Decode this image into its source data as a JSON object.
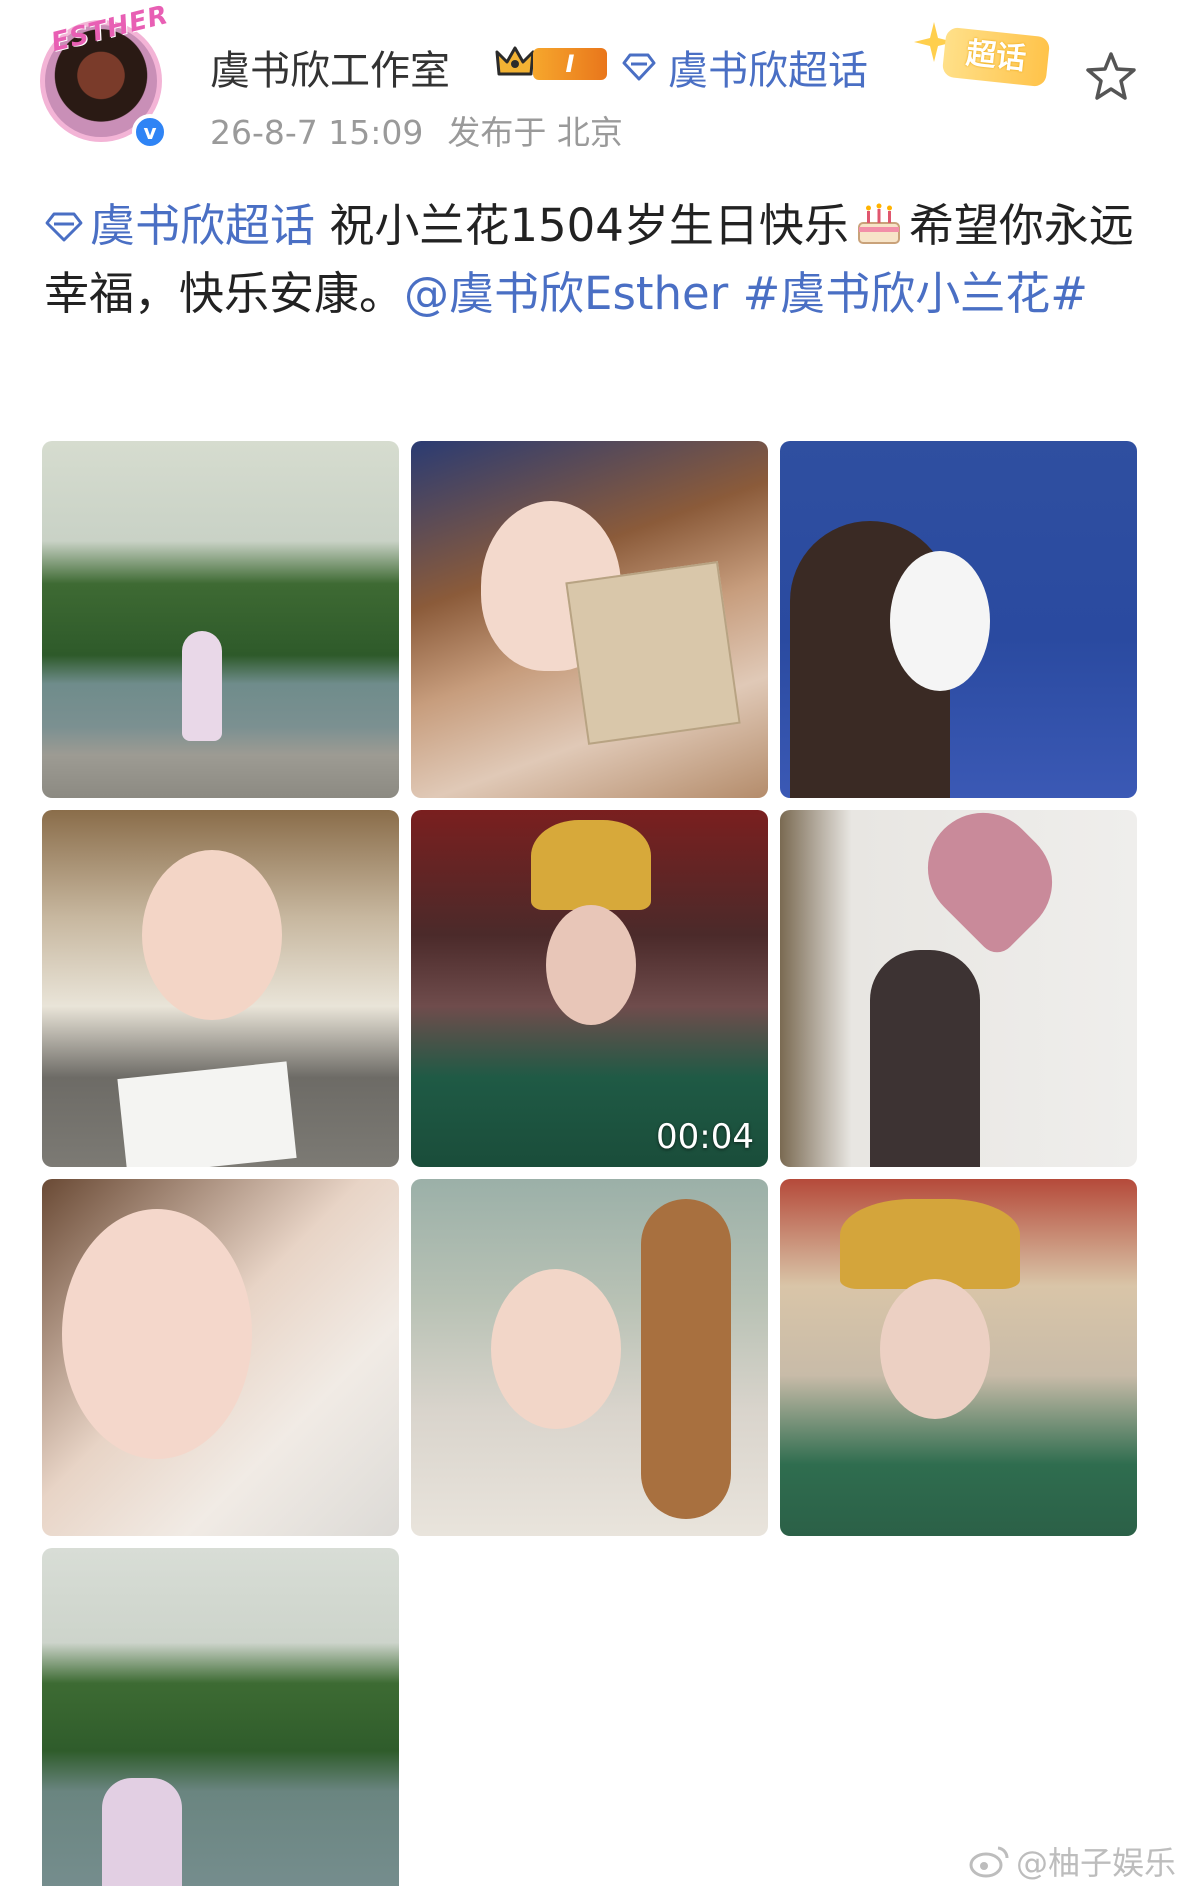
{
  "header": {
    "avatar_text": "ESTHER",
    "verified_mark": "v",
    "username": "虞书欣工作室",
    "level_label": "I",
    "super_topic_label": "虞书欣超话",
    "chaohua_badge_label": "超话",
    "timestamp": "26-8-7 15:09",
    "location": "发布于 北京"
  },
  "post": {
    "topic_link": "虞书欣超话",
    "text_part1": " 祝小兰花1504岁生日快乐",
    "text_part2": "希望你永远幸福，快乐安康。",
    "mention": "@虞书欣Esther",
    "hashtag": "#虞书欣小兰花#"
  },
  "photos": [
    {
      "label": "lake-hills-photo-1"
    },
    {
      "label": "set-selfie-with-paper-photo"
    },
    {
      "label": "white-mask-photo"
    },
    {
      "label": "lying-on-table-photo"
    },
    {
      "label": "bridal-headdress-video",
      "duration": "00:04"
    },
    {
      "label": "heart-balloon-photo"
    },
    {
      "label": "close-up-selfie-photo"
    },
    {
      "label": "feather-fan-photo"
    },
    {
      "label": "red-tassel-crown-photo"
    },
    {
      "label": "lake-hills-photo-2"
    }
  ],
  "watermark": "@柚子娱乐",
  "colors": {
    "link": "#4a6fc4",
    "verified": "#2f84f5",
    "level_badge": "#f6a72d",
    "chaohua_badge": "#ffc34a",
    "meta_text": "#9a9a9a"
  }
}
